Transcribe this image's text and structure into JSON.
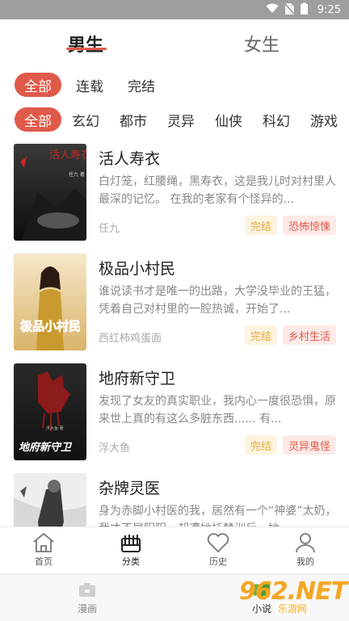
{
  "status_bar": {
    "time": "9:25"
  },
  "gender_tabs": [
    {
      "label": "男生",
      "active": true
    },
    {
      "label": "女生",
      "active": false
    }
  ],
  "status_filters": [
    "全部",
    "连载",
    "完结"
  ],
  "genre_filters": [
    "全部",
    "玄幻",
    "都市",
    "灵异",
    "仙侠",
    "科幻",
    "游戏"
  ],
  "books": [
    {
      "title": "活人寿衣",
      "desc": "白灯笼，红腰绳，黑寿衣，这是我儿时对村里人最深的记忆。 在我的老家有个怪异的...",
      "author": "任九",
      "status": "完结",
      "genre": "恐怖惊悚",
      "cover_text": "活人寿衣",
      "cover_author": "任九 著"
    },
    {
      "title": "极品小村民",
      "desc": "谁说读书才是唯一的出路，大学没毕业的王猛，凭着自己对村里的一腔热诚，开始了...",
      "author": "西红柿鸡蛋面",
      "status": "完结",
      "genre": "乡村生活",
      "cover_text": "极品小村民"
    },
    {
      "title": "地府新守卫",
      "desc": "发现了女友的真实职业，我内心一度很恐惧，原来世上真的有这么多脏东西...... 有...",
      "author": "浮大鱼",
      "status": "完结",
      "genre": "灵异鬼怪",
      "cover_text": "地府新守卫",
      "cover_author": "浮大鱼 著"
    },
    {
      "title": "杂牌灵医",
      "desc": "身为赤脚小村医的我，居然有一个“神婆”太奶，我才不屑阳阳，却遭她托梦训斥，她...",
      "author": "",
      "status": "",
      "genre": ""
    }
  ],
  "nav_primary": [
    {
      "label": "首页",
      "icon": "home-icon",
      "active": false
    },
    {
      "label": "分类",
      "icon": "category-icon",
      "active": true
    },
    {
      "label": "历史",
      "icon": "heart-icon",
      "active": false
    },
    {
      "label": "我的",
      "icon": "user-icon",
      "active": false
    }
  ],
  "nav_secondary": [
    {
      "label": "漫画",
      "icon": "comic-icon",
      "active": false
    },
    {
      "label": "小说",
      "icon": "book-icon",
      "active": true
    }
  ],
  "watermark": {
    "number": "962.NET",
    "text": "乐游网"
  },
  "colors": {
    "accent": "#e05a4a",
    "status_tag": "#e2a93a",
    "nav_active": "#67b346"
  }
}
